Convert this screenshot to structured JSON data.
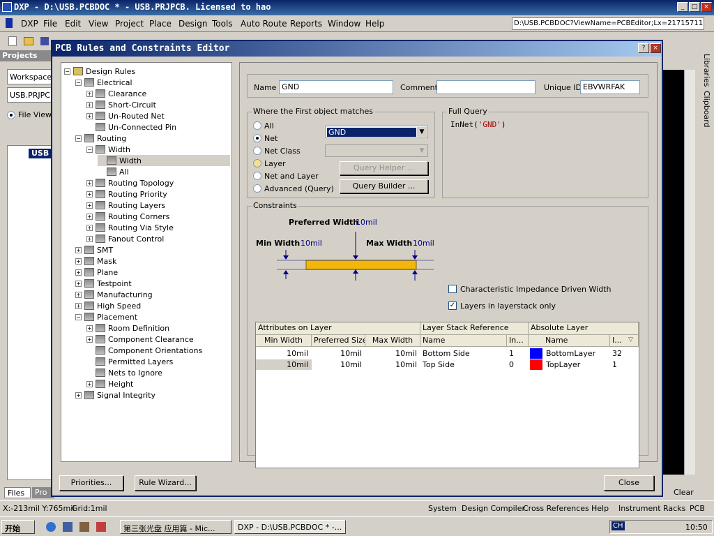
{
  "window": {
    "title": "DXP - D:\\USB.PCBDOC * - USB.PRJPCB. Licensed to hao"
  },
  "menu": [
    "DXP",
    "File",
    "Edit",
    "View",
    "Project",
    "Place",
    "Design",
    "Tools",
    "Auto Route",
    "Reports",
    "Window",
    "Help"
  ],
  "address": "D:\\USB.PCBDOC?ViewName=PCBEditor;Lx=21715711.",
  "left_panel": {
    "title": "Projects",
    "workspace": "Workspace",
    "project": "USB.PRJPC",
    "file_view": "File View",
    "tree_root": "USB",
    "tabs": [
      "Files",
      "Pro"
    ]
  },
  "right_tabs": [
    "Libraries",
    "Clipboard"
  ],
  "dialog": {
    "title": "PCB Rules and Constraints Editor",
    "tree": [
      {
        "label": "Design Rules",
        "level": 0,
        "exp": "-"
      },
      {
        "label": "Electrical",
        "level": 1,
        "exp": "-"
      },
      {
        "label": "Clearance",
        "level": 2,
        "exp": "+"
      },
      {
        "label": "Short-Circuit",
        "level": 2,
        "exp": "+"
      },
      {
        "label": "Un-Routed Net",
        "level": 2,
        "exp": "+"
      },
      {
        "label": "Un-Connected Pin",
        "level": 2,
        "exp": ""
      },
      {
        "label": "Routing",
        "level": 1,
        "exp": "-"
      },
      {
        "label": "Width",
        "level": 2,
        "exp": "-"
      },
      {
        "label": "Width",
        "level": 3,
        "exp": "",
        "selected": true
      },
      {
        "label": "All",
        "level": 3,
        "exp": ""
      },
      {
        "label": "Routing Topology",
        "level": 2,
        "exp": "+"
      },
      {
        "label": "Routing Priority",
        "level": 2,
        "exp": "+"
      },
      {
        "label": "Routing Layers",
        "level": 2,
        "exp": "+"
      },
      {
        "label": "Routing Corners",
        "level": 2,
        "exp": "+"
      },
      {
        "label": "Routing Via Style",
        "level": 2,
        "exp": "+"
      },
      {
        "label": "Fanout Control",
        "level": 2,
        "exp": "+"
      },
      {
        "label": "SMT",
        "level": 1,
        "exp": "+"
      },
      {
        "label": "Mask",
        "level": 1,
        "exp": "+"
      },
      {
        "label": "Plane",
        "level": 1,
        "exp": "+"
      },
      {
        "label": "Testpoint",
        "level": 1,
        "exp": "+"
      },
      {
        "label": "Manufacturing",
        "level": 1,
        "exp": "+"
      },
      {
        "label": "High Speed",
        "level": 1,
        "exp": "+"
      },
      {
        "label": "Placement",
        "level": 1,
        "exp": "-"
      },
      {
        "label": "Room Definition",
        "level": 2,
        "exp": "+"
      },
      {
        "label": "Component Clearance",
        "level": 2,
        "exp": "+"
      },
      {
        "label": "Component Orientations",
        "level": 2,
        "exp": ""
      },
      {
        "label": "Permitted Layers",
        "level": 2,
        "exp": ""
      },
      {
        "label": "Nets to Ignore",
        "level": 2,
        "exp": ""
      },
      {
        "label": "Height",
        "level": 2,
        "exp": "+"
      },
      {
        "label": "Signal Integrity",
        "level": 1,
        "exp": "+"
      }
    ],
    "name_label": "Name",
    "name_value": "GND",
    "comment_label": "Comment",
    "comment_value": "",
    "uid_label": "Unique ID",
    "uid_value": "EBVWRFAK",
    "match_title": "Where the First object matches",
    "match_options": [
      "All",
      "Net",
      "Net Class",
      "Layer",
      "Net and Layer",
      "Advanced (Query)"
    ],
    "net_value": "GND",
    "query_helper": "Query Helper ...",
    "query_builder": "Query Builder ...",
    "full_query_title": "Full Query",
    "full_query_fn": "InNet(",
    "full_query_arg": "'GND'",
    "full_query_end": ")",
    "constraints_title": "Constraints",
    "pref_label": "Preferred Width",
    "pref_val": "10mil",
    "min_label": "Min Width",
    "min_val": "10mil",
    "max_label": "Max Width",
    "max_val": "10mil",
    "chk1": "Characteristic Impedance Driven Width",
    "chk2": "Layers in layerstack only",
    "grid_groups": [
      "Attributes on Layer",
      "Layer Stack Reference",
      "Absolute Layer"
    ],
    "grid_cols": [
      "Min Width",
      "Preferred Size",
      "Max Width",
      "Name",
      "In...",
      "Name",
      "I..."
    ],
    "rows": [
      {
        "min": "10mil",
        "pref": "10mil",
        "max": "10mil",
        "stack": "Bottom Side",
        "idx": "1",
        "color": "#0000ff",
        "layer": "BottomLayer",
        "abs": "32"
      },
      {
        "min": "10mil",
        "pref": "10mil",
        "max": "10mil",
        "stack": "Top Side",
        "idx": "0",
        "color": "#ff0000",
        "layer": "TopLayer",
        "abs": "1"
      }
    ],
    "btn_priorities": "Priorities...",
    "btn_wizard": "Rule Wizard...",
    "btn_close": "Close"
  },
  "status": {
    "coords": "X:-213mil Y:765mil",
    "grid": "Grid:1mil",
    "items": [
      "System",
      "Design Compiler",
      "Cross References",
      "Help",
      "Instrument Racks",
      "PCB"
    ],
    "clear": "Clear"
  },
  "taskbar": {
    "start": "开始",
    "task1": "第三张光盘 应用篇 - Mic...",
    "task2": "DXP - D:\\USB.PCBDOC * -...",
    "lang": "CH",
    "time": "10:50"
  }
}
